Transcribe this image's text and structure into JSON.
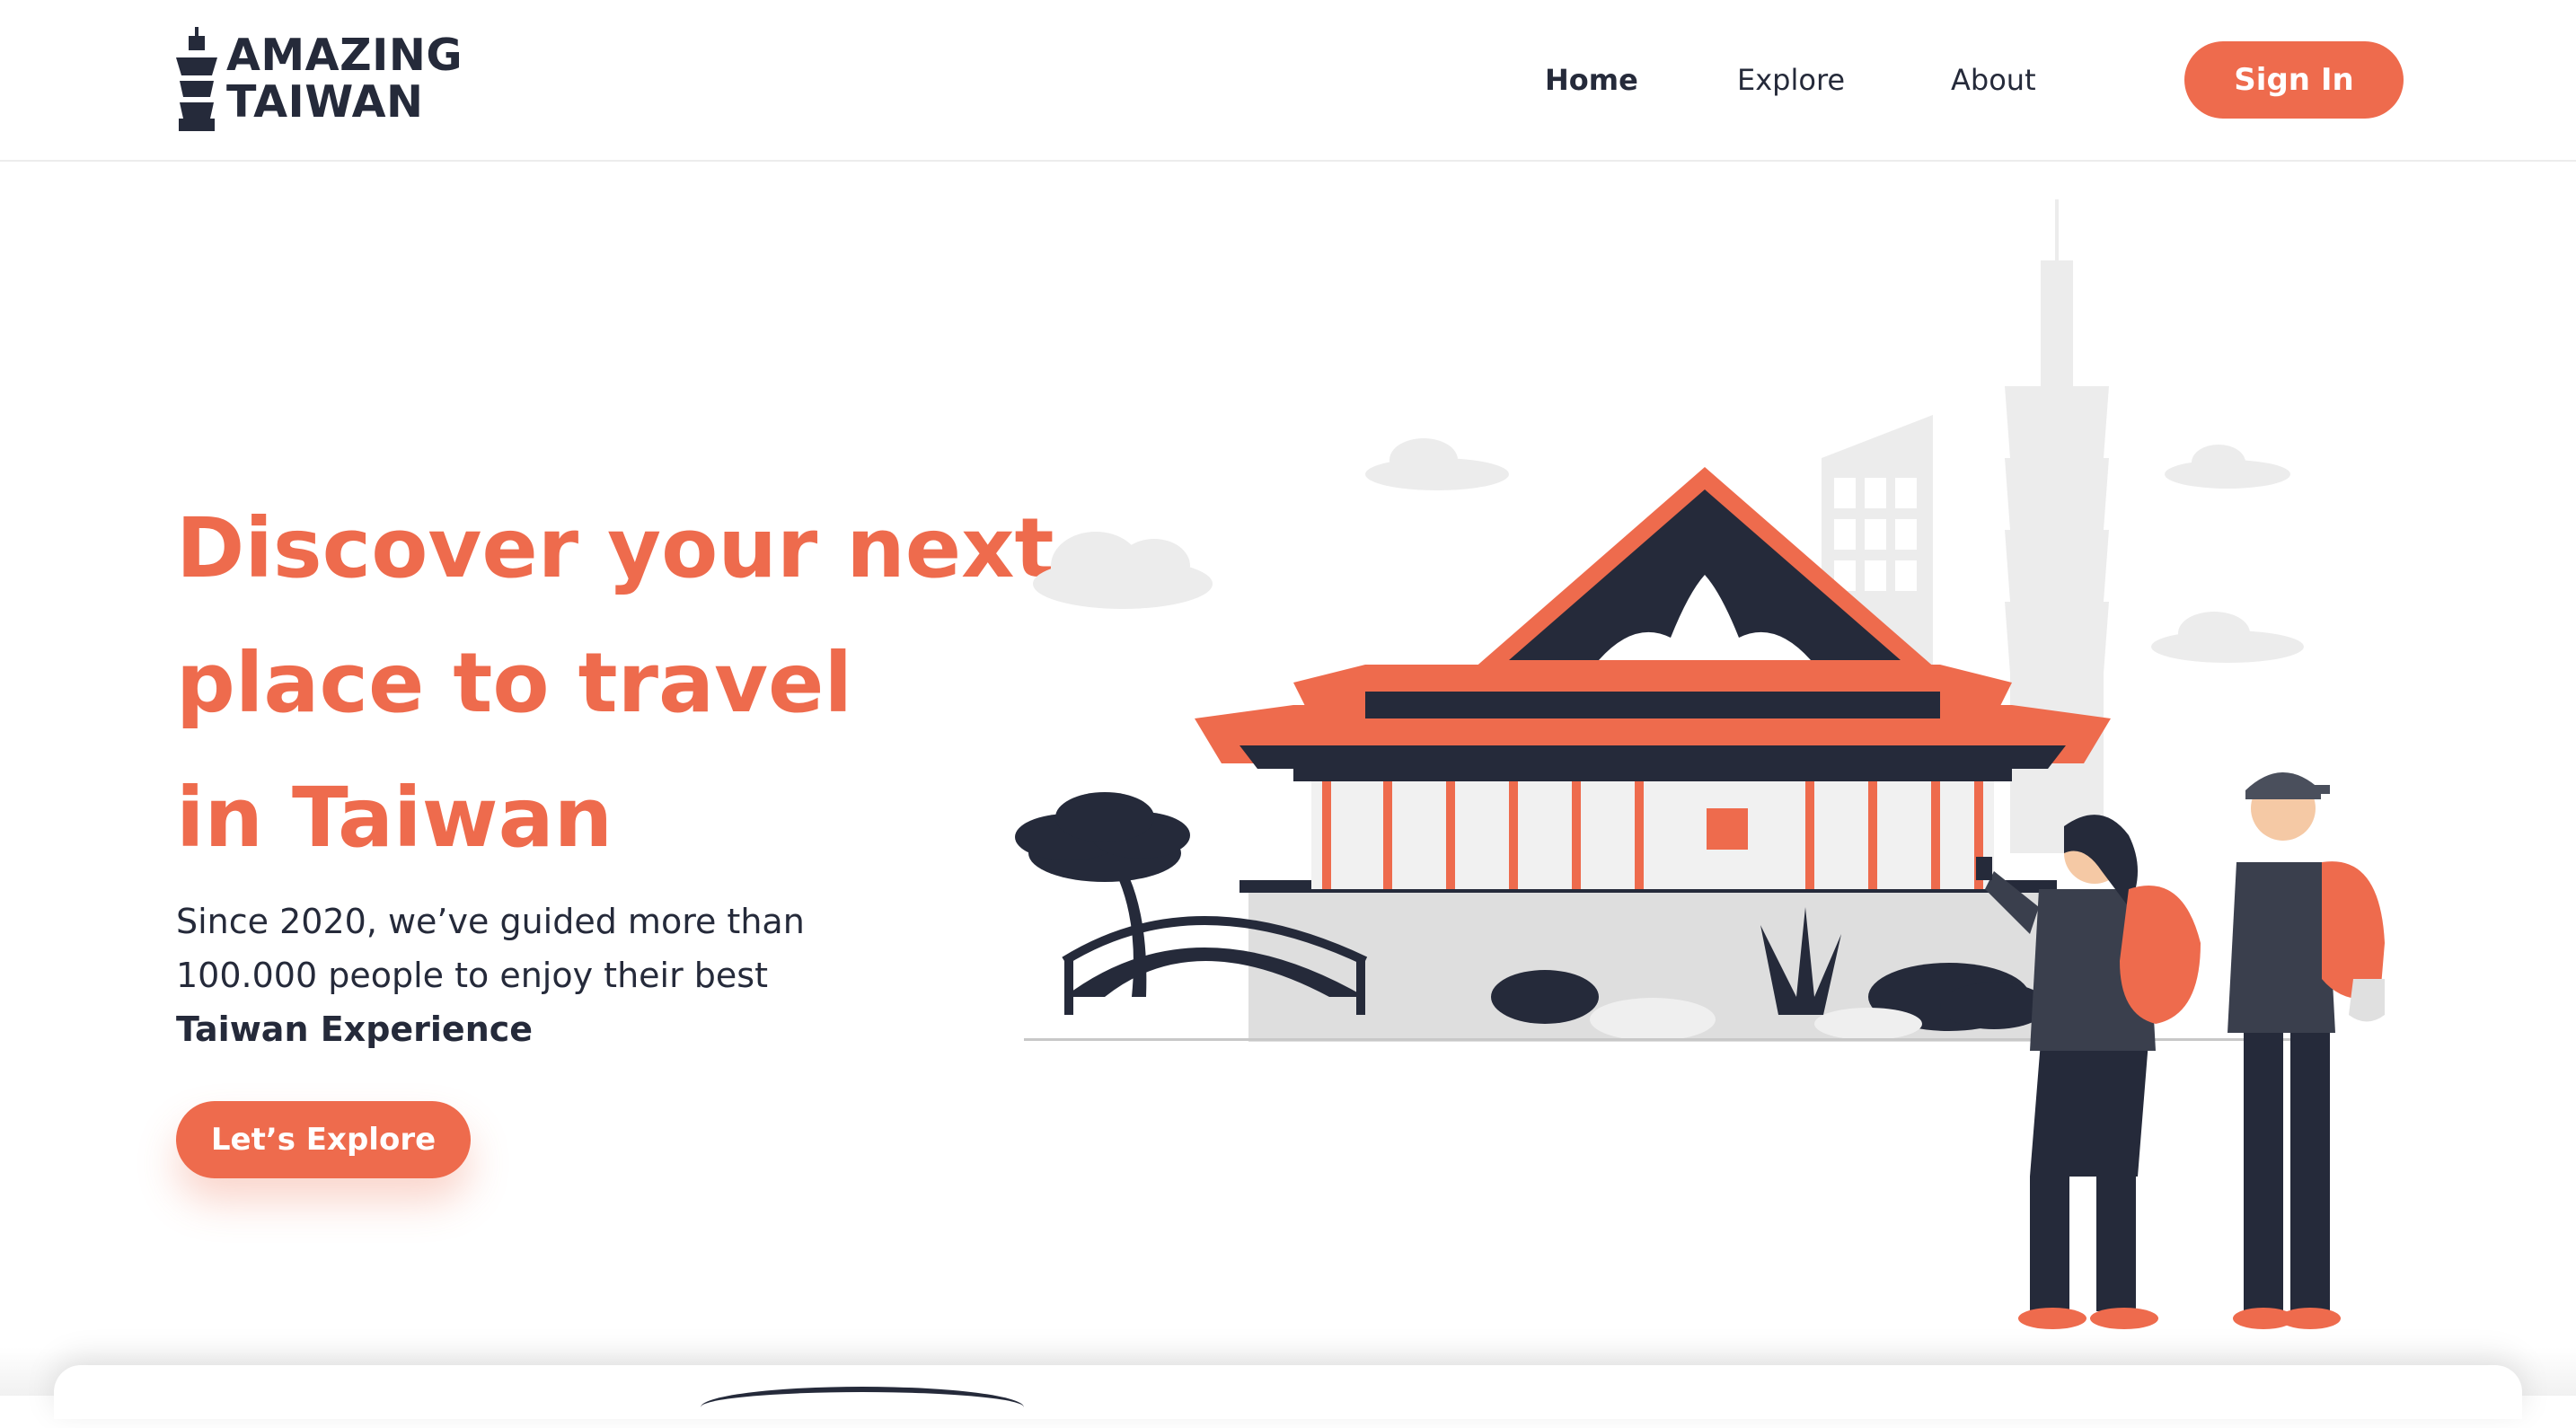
{
  "header": {
    "logo": {
      "line1": "AMAZING",
      "line2": "TAIWAN"
    },
    "nav": [
      {
        "label": "Home",
        "active": true
      },
      {
        "label": "Explore",
        "active": false
      },
      {
        "label": "About",
        "active": false
      }
    ],
    "sign_in_label": "Sign In"
  },
  "hero": {
    "title_lines": [
      "Discover your next",
      "place to travel",
      "in Taiwan"
    ],
    "subtitle_lines": [
      "Since 2020, we’ve guided more than",
      "100.000 people to enjoy their best"
    ],
    "subtitle_strong": "Taiwan Experience",
    "cta_label": "Let’s Explore"
  },
  "colors": {
    "accent": "#ee6b4d",
    "dark": "#252a3a",
    "light_gray": "#e9e9e9",
    "white": "#ffffff"
  },
  "icons": [
    "taipei-101-logo-icon"
  ]
}
